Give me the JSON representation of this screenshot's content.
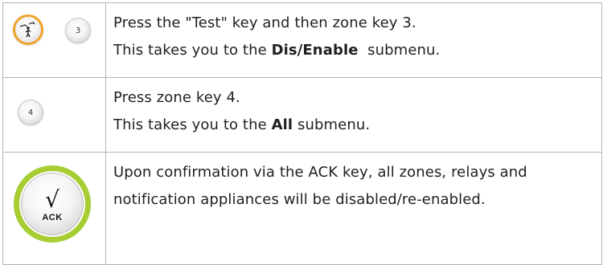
{
  "steps": [
    {
      "keys": [
        {
          "type": "test",
          "icon": "test-key-icon"
        },
        {
          "type": "zone",
          "label": "3"
        }
      ],
      "line1": "Press the \"Test\" key and then zone key 3.",
      "line2_prefix": "This takes you to the ",
      "line2_bold": "Dis/Enable",
      "line2_suffix": "  submenu."
    },
    {
      "keys": [
        {
          "type": "zone",
          "label": "4"
        }
      ],
      "line1": "Press zone key 4.",
      "line2_prefix": "This takes you to the ",
      "line2_bold": "All",
      "line2_suffix": " submenu."
    },
    {
      "keys": [
        {
          "type": "ack",
          "symbol": "√",
          "label": "ACK"
        }
      ],
      "line1": "Upon confirmation via the ACK key, all zones, relays and notification appliances will be disabled/re-enabled."
    }
  ],
  "colors": {
    "test_ring": "#f0a32a",
    "ack_ring": "#a7cd32",
    "border": "#b4b4b4",
    "text": "#1f1f1f"
  }
}
